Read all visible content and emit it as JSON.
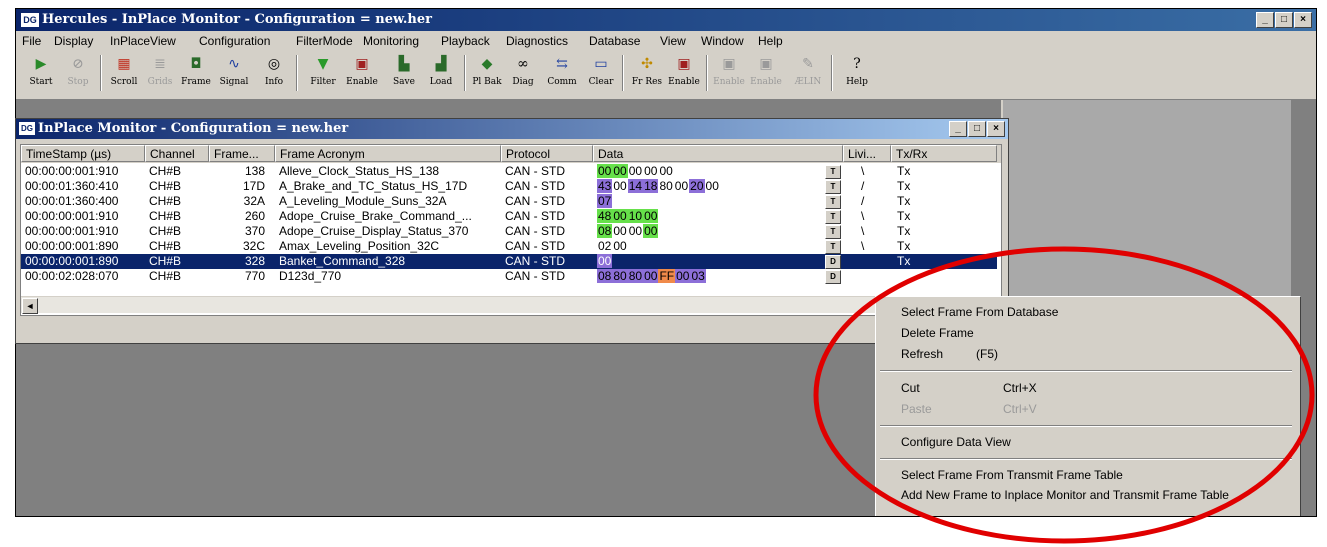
{
  "window": {
    "logo": "DG",
    "title": "Hercules - InPlace Monitor  - Configuration = new.her",
    "buttons": [
      "_",
      "□",
      "×"
    ]
  },
  "menu": [
    "File",
    "Display",
    "InPlaceView",
    "Configuration",
    "FilterMode",
    "Monitoring",
    "Playback",
    "Diagnostics",
    "Database",
    "View",
    "Window",
    "Help"
  ],
  "toolbar": [
    {
      "label": "Start",
      "icon": "start-icon",
      "enabled": true
    },
    {
      "label": "Stop",
      "icon": "stop-icon",
      "enabled": false
    },
    {
      "label": "Scroll",
      "icon": "scroll-icon",
      "enabled": true
    },
    {
      "label": "Grids",
      "icon": "grids-icon",
      "enabled": false
    },
    {
      "label": "Frame",
      "icon": "frame-icon",
      "enabled": true
    },
    {
      "label": "Signal",
      "icon": "signal-icon",
      "enabled": true
    },
    {
      "label": "Info",
      "icon": "info-icon",
      "enabled": true
    },
    {
      "label": "Filter",
      "icon": "filter-icon",
      "enabled": true
    },
    {
      "label": "Enable",
      "icon": "enable-icon",
      "enabled": true
    },
    {
      "label": "Save",
      "icon": "save-icon",
      "enabled": true
    },
    {
      "label": "Load",
      "icon": "load-icon",
      "enabled": true
    },
    {
      "label": "Pl Bak",
      "icon": "playback-icon",
      "enabled": true
    },
    {
      "label": "Diag",
      "icon": "diag-icon",
      "enabled": true
    },
    {
      "label": "Comm",
      "icon": "comm-icon",
      "enabled": true
    },
    {
      "label": "Clear",
      "icon": "clear-icon",
      "enabled": true
    },
    {
      "label": "Fr Res",
      "icon": "frame-res-icon",
      "enabled": true
    },
    {
      "label": "Enable",
      "icon": "enable-r-icon",
      "enabled": true
    },
    {
      "label": "Enable",
      "icon": "enable-u-icon",
      "enabled": false
    },
    {
      "label": "Enable",
      "icon": "enable-p-icon",
      "enabled": false
    },
    {
      "label": "ÆLIN",
      "icon": "pen-icon",
      "enabled": false
    },
    {
      "label": "Help",
      "icon": "help-icon",
      "enabled": true
    }
  ],
  "child": {
    "logo": "DG",
    "title": "InPlace Monitor  - Configuration = new.her",
    "columns": [
      "TimeStamp (µs)",
      "Channel",
      "Frame...",
      "Frame Acronym",
      "Protocol",
      "Data",
      "Livi...",
      "Tx/Rx"
    ],
    "rows": [
      {
        "ts": "00:00:00:001:910",
        "ch": "CH#B",
        "frame": "138",
        "acr": "Alleve_Clock_Status_HS_138",
        "proto": "CAN - STD",
        "data": [
          [
            "00",
            "g"
          ],
          [
            "00",
            "g"
          ],
          [
            "00",
            ""
          ],
          [
            "00",
            ""
          ],
          [
            "00",
            ""
          ]
        ],
        "btn": "T",
        "live": "\\",
        "txrx": "Tx",
        "selected": false
      },
      {
        "ts": "00:00:01:360:410",
        "ch": "CH#B",
        "frame": "17D",
        "acr": "A_Brake_and_TC_Status_HS_17D",
        "proto": "CAN - STD",
        "data": [
          [
            "43",
            "p"
          ],
          [
            "00",
            ""
          ],
          [
            "14",
            "p"
          ],
          [
            "18",
            "p"
          ],
          [
            "80",
            ""
          ],
          [
            "00",
            ""
          ],
          [
            "20",
            "p"
          ],
          [
            "00",
            ""
          ]
        ],
        "btn": "T",
        "live": "/",
        "txrx": "Tx",
        "selected": false
      },
      {
        "ts": "00:00:01:360:400",
        "ch": "CH#B",
        "frame": "32A",
        "acr": "A_Leveling_Module_Suns_32A",
        "proto": "CAN - STD",
        "data": [
          [
            "07",
            "p"
          ]
        ],
        "btn": "T",
        "live": "/",
        "txrx": "Tx",
        "selected": false
      },
      {
        "ts": "00:00:00:001:910",
        "ch": "CH#B",
        "frame": "260",
        "acr": "Adope_Cruise_Brake_Command_...",
        "proto": "CAN - STD",
        "data": [
          [
            "48",
            "g"
          ],
          [
            "00",
            "g"
          ],
          [
            "10",
            "g"
          ],
          [
            "00",
            "g"
          ]
        ],
        "btn": "T",
        "live": "\\",
        "txrx": "Tx",
        "selected": false
      },
      {
        "ts": "00:00:00:001:910",
        "ch": "CH#B",
        "frame": "370",
        "acr": "Adope_Cruise_Display_Status_370",
        "proto": "CAN - STD",
        "data": [
          [
            "08",
            "g"
          ],
          [
            "00",
            ""
          ],
          [
            "00",
            ""
          ],
          [
            "00",
            "g"
          ]
        ],
        "btn": "T",
        "live": "\\",
        "txrx": "Tx",
        "selected": false
      },
      {
        "ts": "00:00:00:001:890",
        "ch": "CH#B",
        "frame": "32C",
        "acr": "Amax_Leveling_Position_32C",
        "proto": "CAN - STD",
        "data": [
          [
            "02",
            ""
          ],
          [
            "00",
            ""
          ]
        ],
        "btn": "T",
        "live": "\\",
        "txrx": "Tx",
        "selected": false
      },
      {
        "ts": "00:00:00:001:890",
        "ch": "CH#B",
        "frame": "328",
        "acr": "Banket_Command_328",
        "proto": "CAN - STD",
        "data": [
          [
            "00",
            "p"
          ]
        ],
        "btn": "D",
        "live": "",
        "txrx": "Tx",
        "selected": true
      },
      {
        "ts": "00:00:02:028:070",
        "ch": "CH#B",
        "frame": "770",
        "acr": "D123d_770",
        "proto": "CAN - STD",
        "data": [
          [
            "08",
            "p"
          ],
          [
            "80",
            "p"
          ],
          [
            "80",
            "p"
          ],
          [
            "00",
            "p"
          ],
          [
            "FF",
            "o"
          ],
          [
            "00",
            "p"
          ],
          [
            "03",
            "p"
          ]
        ],
        "btn": "D",
        "live": "",
        "txrx": "",
        "selected": false
      }
    ],
    "scroll_arrow": "◄"
  },
  "context_menu": {
    "groups": [
      [
        {
          "label": "Select Frame From Database",
          "enabled": true
        },
        {
          "label": "Delete Frame",
          "enabled": true
        },
        {
          "label": "Refresh",
          "shortcut": "(F5)",
          "enabled": true
        }
      ],
      [
        {
          "label": "Cut",
          "shortcut": "Ctrl+X",
          "enabled": true
        },
        {
          "label": "Paste",
          "shortcut": "Ctrl+V",
          "enabled": false
        }
      ],
      [
        {
          "label": "Configure Data View",
          "enabled": true
        }
      ],
      [
        {
          "label": "Select Frame From Transmit Frame Table",
          "enabled": true
        },
        {
          "label": "Add New Frame to Inplace Monitor and Transmit Frame Table",
          "enabled": true
        }
      ]
    ]
  },
  "colors": {
    "title_bar": "#0a246a",
    "selection": "#0a246a",
    "highlight_green": "#66e04a",
    "highlight_purple": "#8c6fd8",
    "highlight_orange": "#f08a4a",
    "annotation_ellipse": "#e00000"
  }
}
